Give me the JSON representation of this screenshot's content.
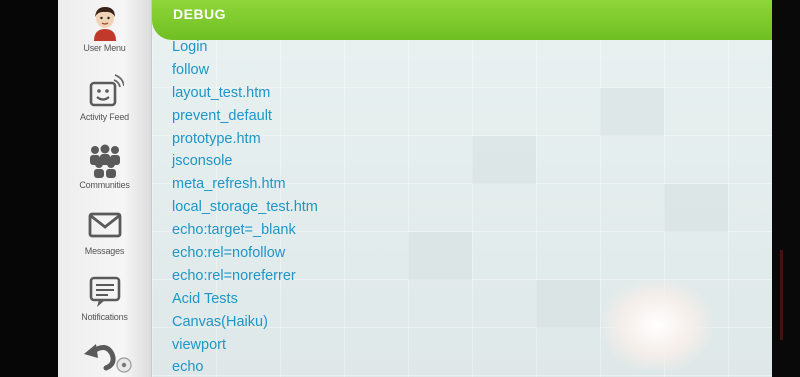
{
  "header": {
    "title": "DEBUG"
  },
  "sidebar": {
    "items": [
      {
        "label": "User Menu",
        "icon": "user-avatar-icon"
      },
      {
        "label": "Activity Feed",
        "icon": "smiley-feed-icon"
      },
      {
        "label": "Communities",
        "icon": "people-group-icon"
      },
      {
        "label": "Messages",
        "icon": "envelope-icon"
      },
      {
        "label": "Notifications",
        "icon": "notification-list-icon"
      }
    ],
    "back_icon": "back-arrow-icon"
  },
  "links": [
    "Login",
    "follow",
    "layout_test.htm",
    "prevent_default",
    "prototype.htm",
    "jsconsole",
    "meta_refresh.htm",
    "local_storage_test.htm",
    "echo:target=_blank",
    "echo:rel=nofollow",
    "echo:rel=noreferrer",
    "Acid Tests",
    "Canvas(Haiku)",
    "viewport",
    "echo"
  ],
  "colors": {
    "header_green": "#7cc82c",
    "link_blue": "#1e96c8",
    "background": "#e6eeee"
  }
}
